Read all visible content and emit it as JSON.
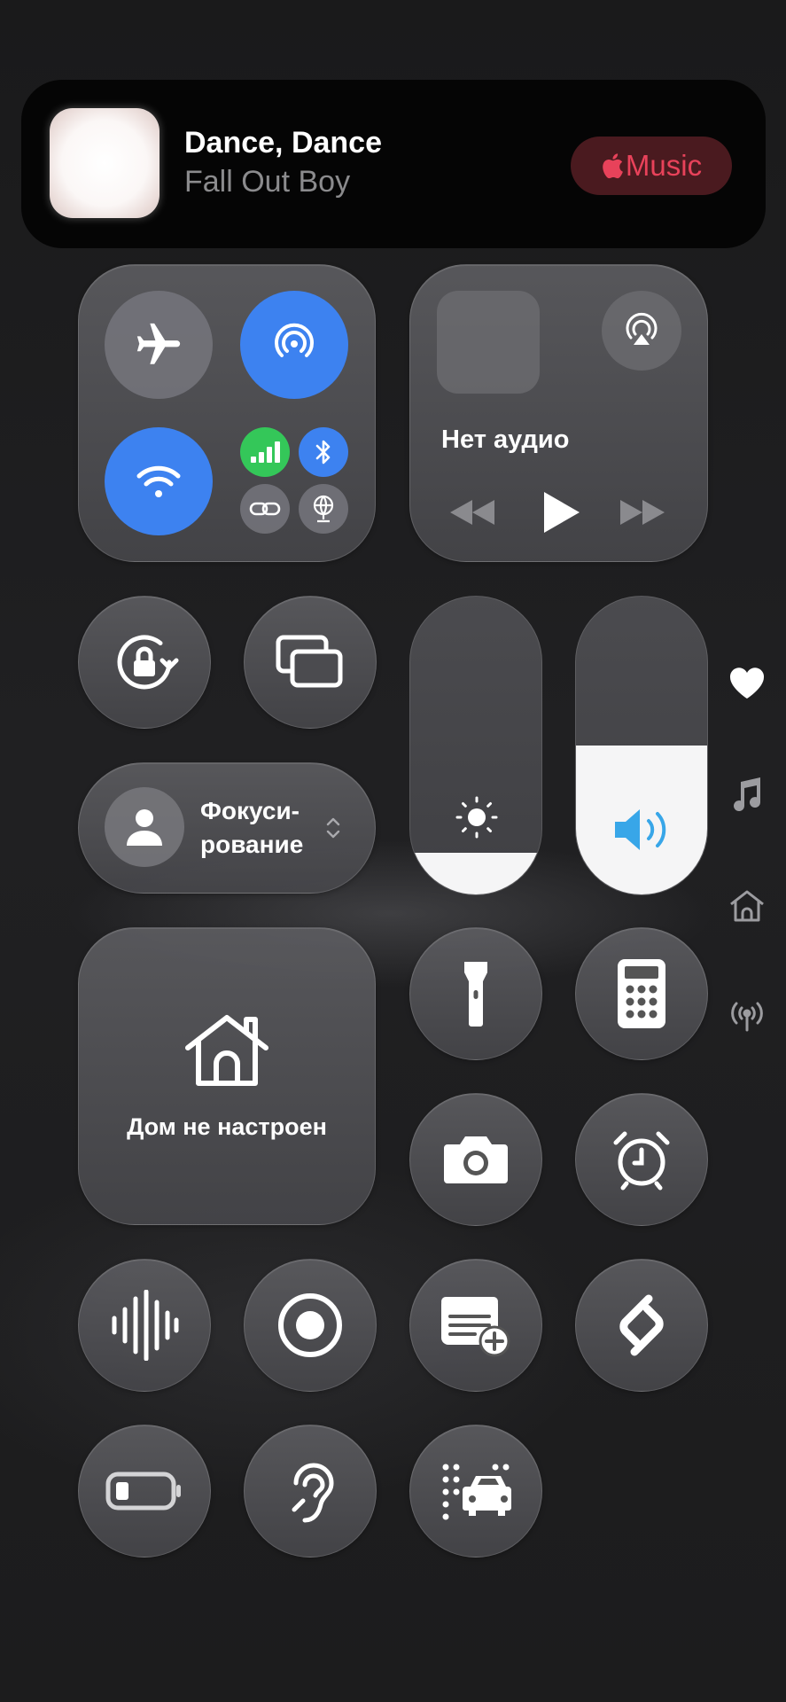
{
  "now_playing": {
    "title": "Dance, Dance",
    "artist": "Fall Out Boy",
    "service_label": "Music",
    "service_icon": "apple-logo-icon",
    "service_color": "#e8425a"
  },
  "connectivity": {
    "airplane_mode": false,
    "airdrop": true,
    "wifi": true,
    "cellular": true,
    "bluetooth": true,
    "icons": [
      "airplane-icon",
      "airdrop-icon",
      "wifi-icon",
      "cellular-icon",
      "bluetooth-icon",
      "personal-hotspot-icon",
      "vpn-globe-icon"
    ],
    "accent_blue": "#3d82f0",
    "accent_green": "#34c759"
  },
  "audio": {
    "status_text": "Нет аудио",
    "icons": [
      "airplay-icon",
      "rewind-icon",
      "play-icon",
      "fast-forward-icon"
    ]
  },
  "focus": {
    "label": "Фокуси-\nрование"
  },
  "sliders": {
    "brightness_level": 0.14,
    "volume_level": 0.5
  },
  "home": {
    "label": "Дом не настроен"
  },
  "controls": [
    "orientation-lock-icon",
    "screen-mirroring-icon",
    "flashlight-icon",
    "calculator-icon",
    "camera-icon",
    "alarm-icon",
    "voice-memo-icon",
    "screen-record-icon",
    "quick-note-icon",
    "shazam-icon",
    "low-power-icon",
    "hearing-icon",
    "vehicle-motion-cues-icon"
  ],
  "side_pages": [
    "heart-icon",
    "music-note-icon",
    "home-icon",
    "antenna-icon"
  ]
}
